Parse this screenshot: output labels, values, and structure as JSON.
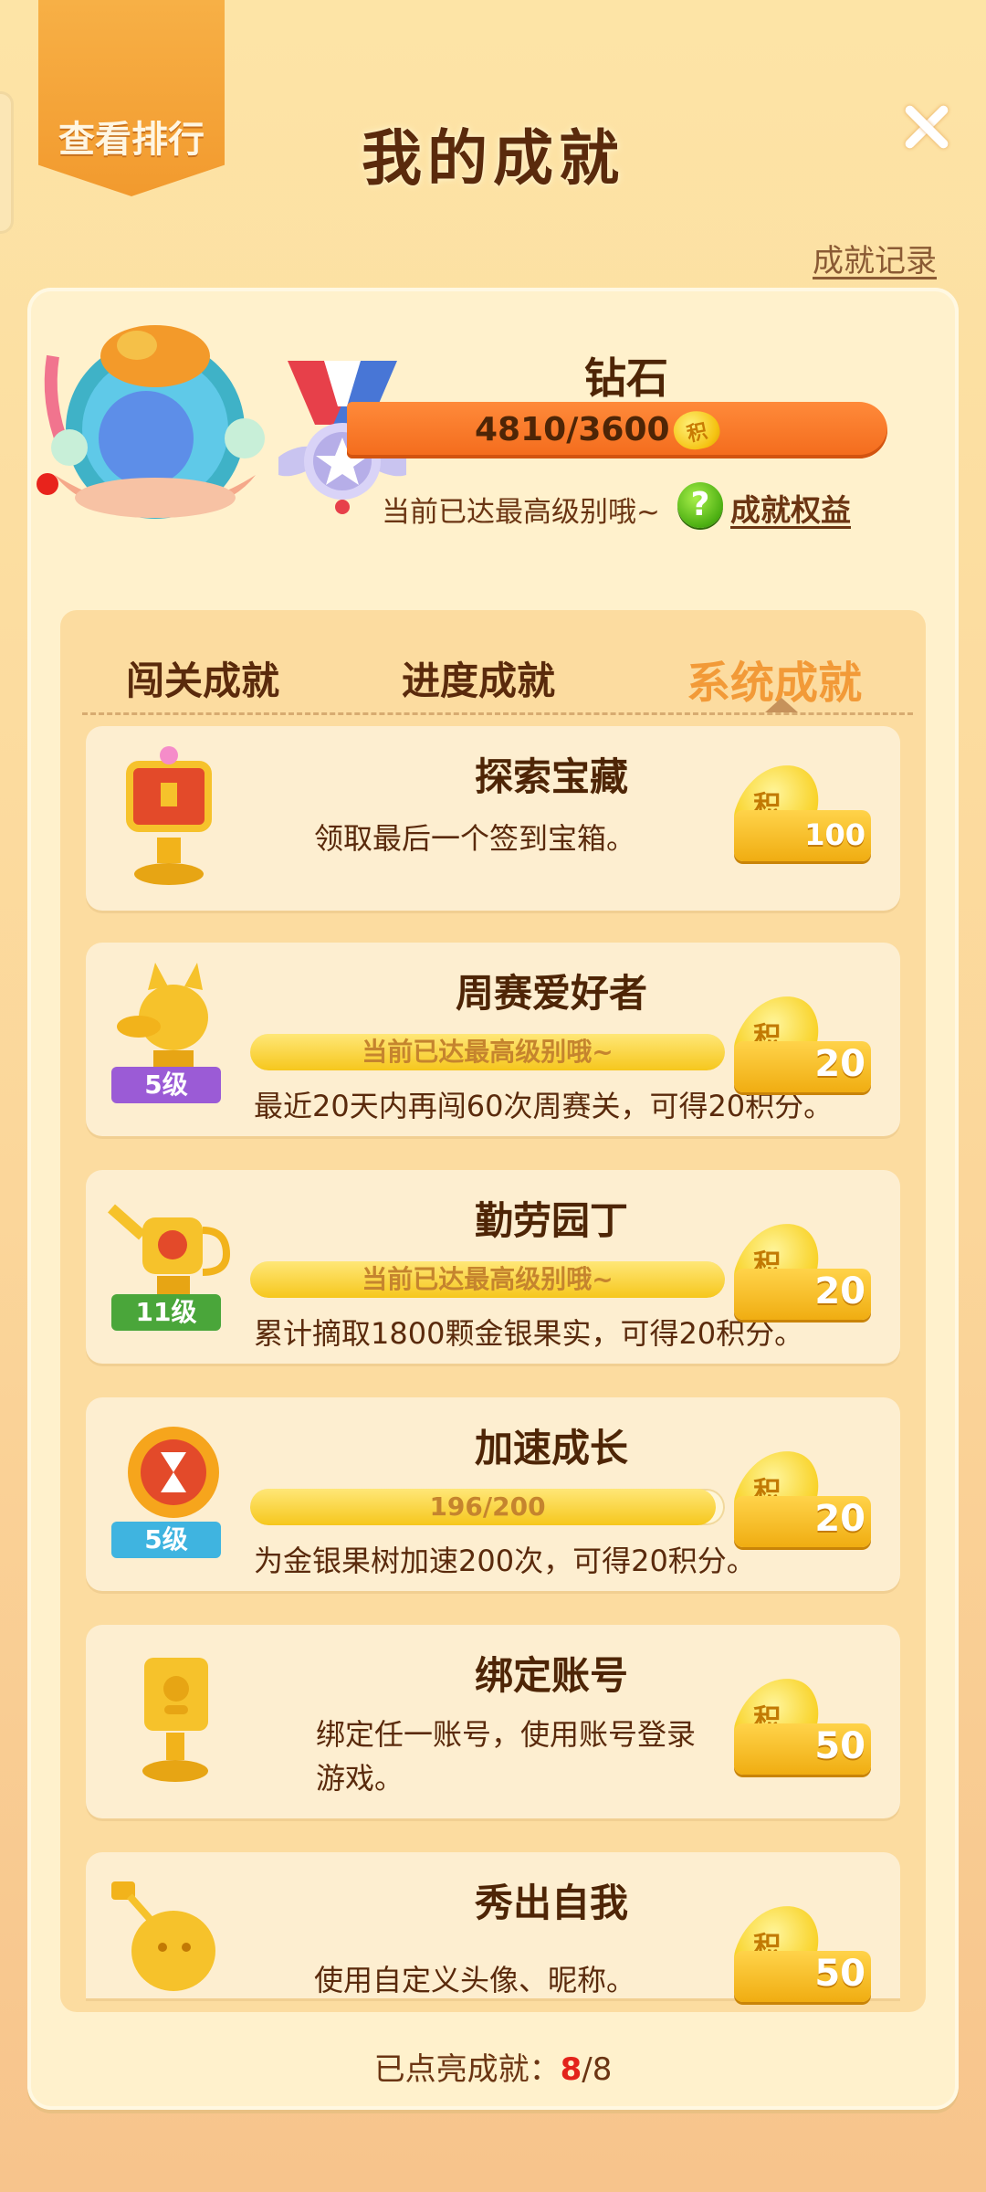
{
  "header": {
    "rank_button": "查看排行",
    "title": "我的成就",
    "record_link": "成就记录"
  },
  "profile": {
    "level_name": "钻石",
    "points_progress": "4810/3600",
    "points_icon": "积",
    "max_level_note": "当前已达最高级别哦~",
    "benefits_link": "成就权益"
  },
  "tabs": [
    {
      "label": "闯关成就",
      "active": false
    },
    {
      "label": "进度成就",
      "active": false
    },
    {
      "label": "系统成就",
      "active": true
    }
  ],
  "achievements": [
    {
      "title": "探索宝藏",
      "desc": "领取最后一个签到宝箱。",
      "reward": "100",
      "reward_icon": "积",
      "icon": "treasure-chest-trophy-icon"
    },
    {
      "title": "周赛爱好者",
      "level": "5级",
      "bar_text": "当前已达最高级别哦~",
      "progress": 1.0,
      "desc": "最近20天内再闯60次周赛关，可得20积分。",
      "reward": "20",
      "reward_icon": "积",
      "icon": "fox-trophy-icon",
      "level_color": "#9b5bd6"
    },
    {
      "title": "勤劳园丁",
      "level": "11级",
      "bar_text": "当前已达最高级别哦~",
      "progress": 1.0,
      "desc": "累计摘取1800颗金银果实，可得20积分。",
      "reward": "20",
      "reward_icon": "积",
      "icon": "watering-can-trophy-icon",
      "level_color": "#4aa63a"
    },
    {
      "title": "加速成长",
      "level": "5级",
      "bar_text": "196/200",
      "progress": 0.98,
      "desc": "为金银果树加速200次，可得20积分。",
      "reward": "20",
      "reward_icon": "积",
      "icon": "hourglass-medal-icon",
      "level_color": "#3fb4e0"
    },
    {
      "title": "绑定账号",
      "desc": "绑定任一账号，使用账号登录游戏。",
      "reward": "50",
      "reward_icon": "积",
      "icon": "account-trophy-icon"
    },
    {
      "title": "秀出自我",
      "desc": "使用自定义头像、昵称。",
      "reward": "50",
      "reward_icon": "积",
      "icon": "mascot-trophy-icon"
    }
  ],
  "footer": {
    "label": "已点亮成就：",
    "lit": "8",
    "total": "/8"
  },
  "colors": {
    "accent": "#f29a38",
    "xp_bar": "#f36b1c",
    "title_text": "#4e2506"
  }
}
